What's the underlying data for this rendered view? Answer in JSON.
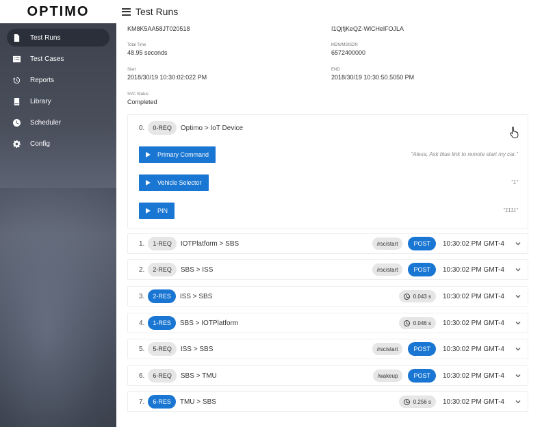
{
  "app": {
    "logo": "OPTIMO",
    "page_title": "Test Runs"
  },
  "sidebar": {
    "items": [
      {
        "label": "Test Runs",
        "icon": "file-icon",
        "active": true
      },
      {
        "label": "Test Cases",
        "icon": "list-icon"
      },
      {
        "label": "Reports",
        "icon": "history-icon"
      },
      {
        "label": "Library",
        "icon": "book-icon"
      },
      {
        "label": "Scheduler",
        "icon": "clock-icon"
      },
      {
        "label": "Config",
        "icon": "gear-icon"
      }
    ]
  },
  "info": {
    "vin": "KM8K5AA58JT020518",
    "id": "I1QjfjKeQZ-WlCHelFOJLA",
    "total_time_label": "Total Time",
    "total_time": "48.95 seconds",
    "mdn_label": "MDN/MSISDN",
    "mdn": "6572400000",
    "start_label": "Start",
    "start": "2018/30/19 10:30:02:022 PM",
    "end_label": "END",
    "end": "2018/30/19 10:30:50.5050 PM",
    "svc_label": "SVC Status",
    "svc": "Completed"
  },
  "steps": {
    "index": "0.",
    "tag": "0-REQ",
    "route": "Optimo > IoT Device",
    "commands": [
      {
        "label": "Primary Command",
        "text": "\"Alexa, Ask blue link to remote start my car.\""
      },
      {
        "label": "Vehicle Selector",
        "text": "\"1\""
      },
      {
        "label": "PIN",
        "text": "\"1111\""
      }
    ]
  },
  "rows": [
    {
      "index": "1.",
      "tag": "1-REQ",
      "blue": false,
      "route": "IOTPlatform > SBS",
      "endpoint": "/rsc/start",
      "method": "POST",
      "time": "10:30:02 PM GMT-4"
    },
    {
      "index": "2.",
      "tag": "2-REQ",
      "blue": false,
      "route": "SBS > ISS",
      "endpoint": "/rsc/start",
      "method": "POST",
      "time": "10:30:02 PM GMT-4"
    },
    {
      "index": "3.",
      "tag": "2-RES",
      "blue": true,
      "route": "ISS > SBS",
      "duration": "0.043 s",
      "time": "10:30:02 PM GMT-4"
    },
    {
      "index": "4.",
      "tag": "1-RES",
      "blue": true,
      "route": "SBS > IOTPlatform",
      "duration": "0.046 s",
      "time": "10:30:02 PM GMT-4"
    },
    {
      "index": "5.",
      "tag": "5-REQ",
      "blue": false,
      "route": "ISS > SBS",
      "endpoint": "/rsc/start",
      "method": "POST",
      "time": "10:30:02 PM GMT-4"
    },
    {
      "index": "6.",
      "tag": "6-REQ",
      "blue": false,
      "route": "SBS > TMU",
      "endpoint": "/wakeup",
      "method": "POST",
      "time": "10:30:02 PM GMT-4"
    },
    {
      "index": "7.",
      "tag": "6-RES",
      "blue": true,
      "route": "TMU > SBS",
      "duration": "0.256 s",
      "time": "10:30:02 PM GMT-4"
    }
  ]
}
